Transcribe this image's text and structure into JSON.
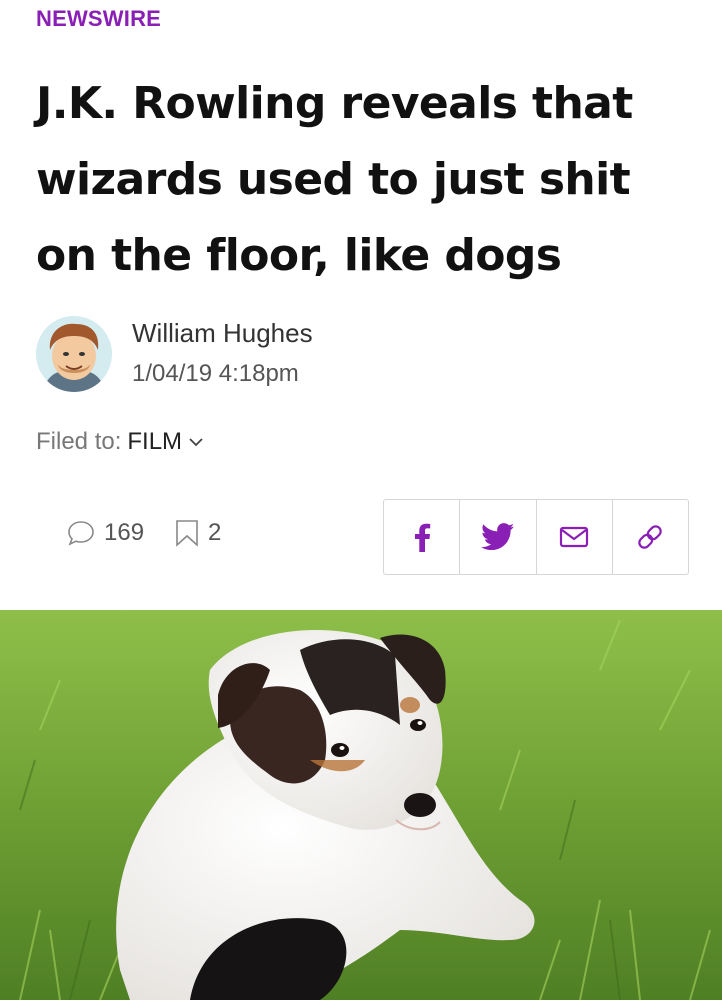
{
  "colors": {
    "accent": "#8a1fb5",
    "text": "#111111",
    "muted": "#777777"
  },
  "section": {
    "label": "NEWSWIRE"
  },
  "article": {
    "headline": "J.K. Rowling reveals that wizards used to just shit on the floor, like dogs"
  },
  "author": {
    "name": "William Hughes",
    "date": "1/04/19 4:18pm",
    "avatar_icon": "cartoon-avatar"
  },
  "filed": {
    "prefix": "Filed to:",
    "category": "FILM",
    "dropdown_icon": "chevron-down-icon"
  },
  "stats": {
    "comments": "169",
    "bookmarks": "2",
    "comment_icon": "speech-bubble-icon",
    "bookmark_icon": "bookmark-icon"
  },
  "share": {
    "buttons": [
      "facebook-icon",
      "twitter-icon",
      "email-icon",
      "link-icon"
    ]
  },
  "hero_image": {
    "subject": "puppy-on-grass"
  }
}
